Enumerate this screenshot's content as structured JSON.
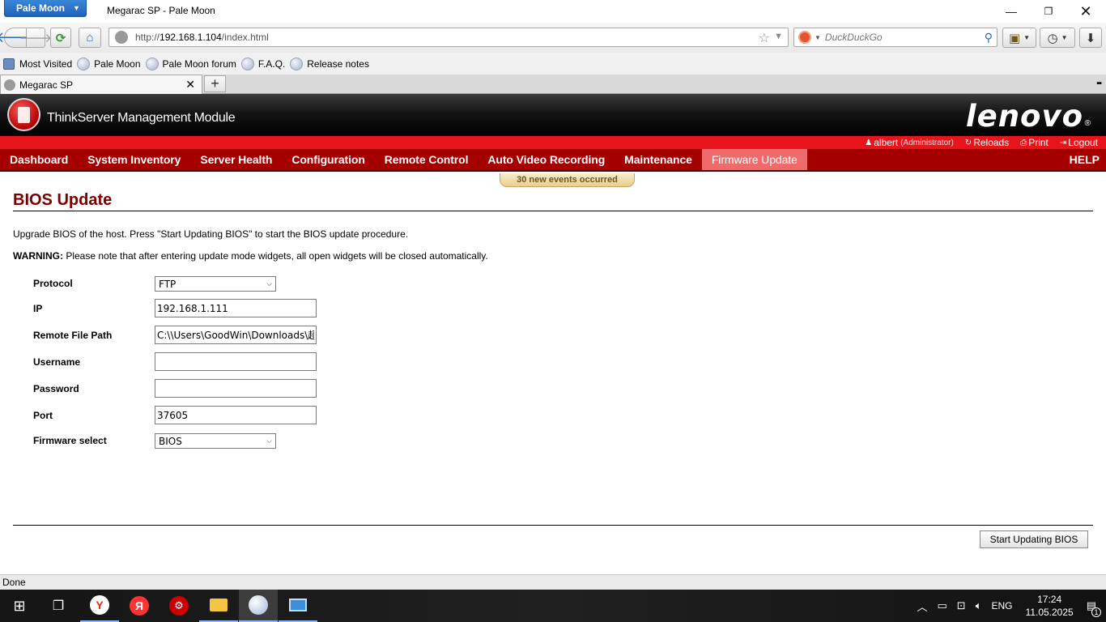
{
  "browser": {
    "app_menu_label": "Pale Moon",
    "window_title": "Megarac SP - Pale Moon",
    "url_prefix": "http://",
    "url_host": "192.168.1.104",
    "url_path": "/index.html",
    "search_placeholder": "DuckDuckGo",
    "bookmarks": [
      "Most Visited",
      "Pale Moon",
      "Pale Moon forum",
      "F.A.Q.",
      "Release notes"
    ],
    "tab_title": "Megarac SP",
    "status_text": "Done"
  },
  "header": {
    "product_title": "ThinkServer Management Module",
    "brand": "lenovo",
    "brand_mark": "®"
  },
  "userbar": {
    "username": "albert",
    "role": "(Administrator)",
    "reload": "Reloads",
    "print": "Print",
    "logout": "Logout"
  },
  "menu": {
    "items": [
      "Dashboard",
      "System Inventory",
      "Server Health",
      "Configuration",
      "Remote Control",
      "Auto Video Recording",
      "Maintenance",
      "Firmware Update"
    ],
    "active": "Firmware Update",
    "help": "HELP"
  },
  "events_badge": "30 new events occurred",
  "page": {
    "title": "BIOS Update",
    "description": "Upgrade BIOS of the host. Press \"Start Updating BIOS\" to start the BIOS update procedure.",
    "warning_label": "WARNING:",
    "warning_text": " Please note that after entering update mode widgets, all open widgets will be closed automatically.",
    "form": {
      "protocol_label": "Protocol",
      "protocol_value": "FTP",
      "ip_label": "IP",
      "ip_value": "192.168.1.111",
      "path_label": "Remote File Path",
      "path_value": "C:\\\\Users\\GoodWin\\Downloads\\超",
      "username_label": "Username",
      "username_value": "",
      "password_label": "Password",
      "password_value": "",
      "port_label": "Port",
      "port_value": "37605",
      "firmware_label": "Firmware select",
      "firmware_value": "BIOS"
    },
    "start_button": "Start Updating BIOS"
  },
  "taskbar": {
    "lang": "ENG",
    "time": "17:24",
    "date": "11.05.2025",
    "notification_count": "1"
  }
}
